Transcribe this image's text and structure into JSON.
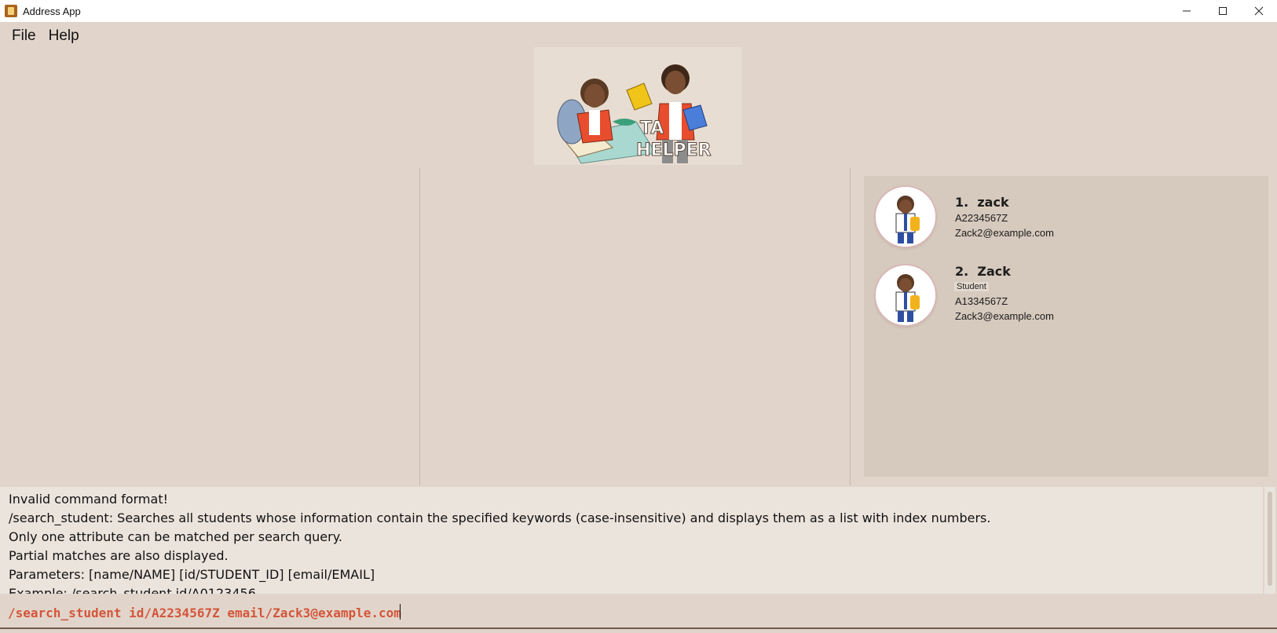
{
  "window": {
    "title": "Address App",
    "controls": [
      "minimize-icon",
      "maximize-icon",
      "close-icon"
    ]
  },
  "menu": {
    "items": [
      "File",
      "Help"
    ]
  },
  "logo": {
    "text": "TA HELPER"
  },
  "students": [
    {
      "index": "1.",
      "name": "zack",
      "tags": [],
      "id": "A2234567Z",
      "email": "Zack2@example.com"
    },
    {
      "index": "2.",
      "name": "Zack",
      "tags": [
        "Student"
      ],
      "id": "A1334567Z",
      "email": "Zack3@example.com"
    }
  ],
  "result": {
    "lines": [
      "Invalid command format!",
      "/search_student: Searches all students whose information contain the specified keywords (case-insensitive) and displays them as a list with index numbers.",
      "Only one attribute can be matched per search query.",
      "Partial matches are also displayed.",
      "Parameters: [name/NAME] [id/STUDENT_ID] [email/EMAIL]",
      "Example: /search_student id/A0123456"
    ]
  },
  "command": {
    "value": "/search_student id/A2234567Z email/Zack3@example.com"
  },
  "colors": {
    "background": "#e1d5cb",
    "list_panel": "#d6c9bd",
    "command_text": "#d4553a"
  }
}
